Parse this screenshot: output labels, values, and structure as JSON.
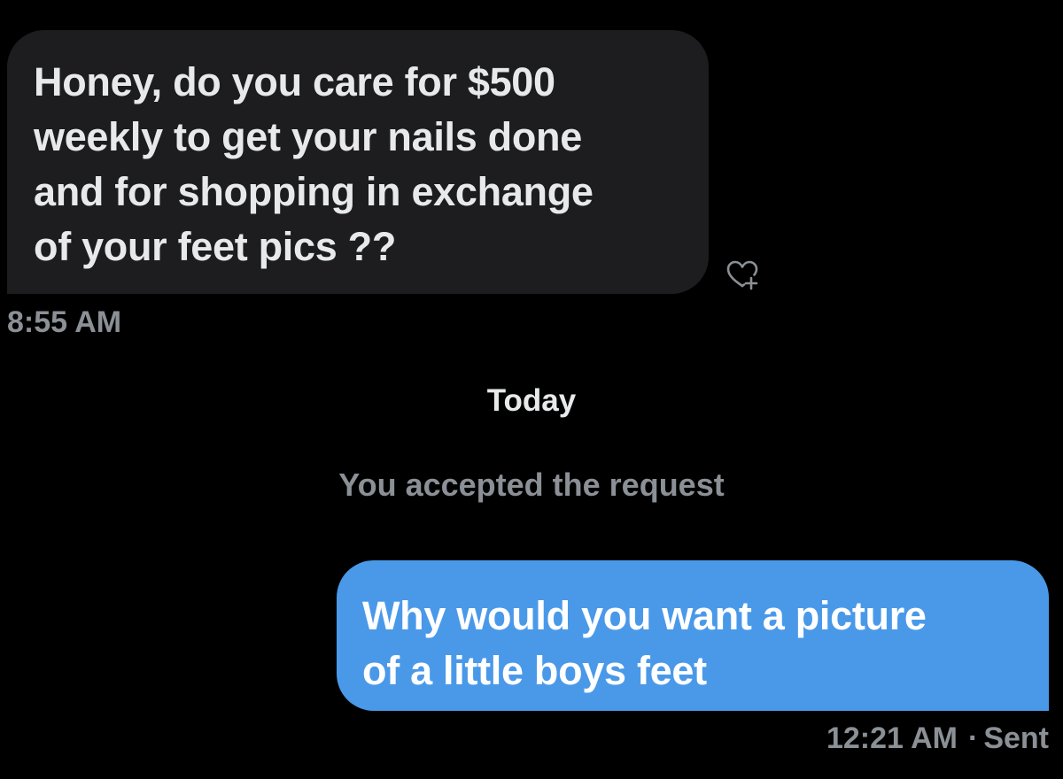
{
  "conversation": {
    "received_message": {
      "text": "Honey, do you care for $500\nweekly to get your nails done\nand for shopping in exchange\nof your feet pics ??",
      "timestamp": "8:55 AM",
      "reaction_icon": "heart-plus-icon"
    },
    "day_divider": "Today",
    "system_note": "You accepted the request",
    "sent_message": {
      "text": "Why would you want a picture\nof a little boys feet",
      "timestamp": "12:21 AM",
      "separator": "·",
      "status": "Sent"
    }
  },
  "colors": {
    "background": "#000000",
    "received_bubble": "#1d1d1f",
    "sent_bubble": "#4a99e9",
    "primary_text": "#e7e9ea",
    "muted_text": "#8b9096"
  }
}
